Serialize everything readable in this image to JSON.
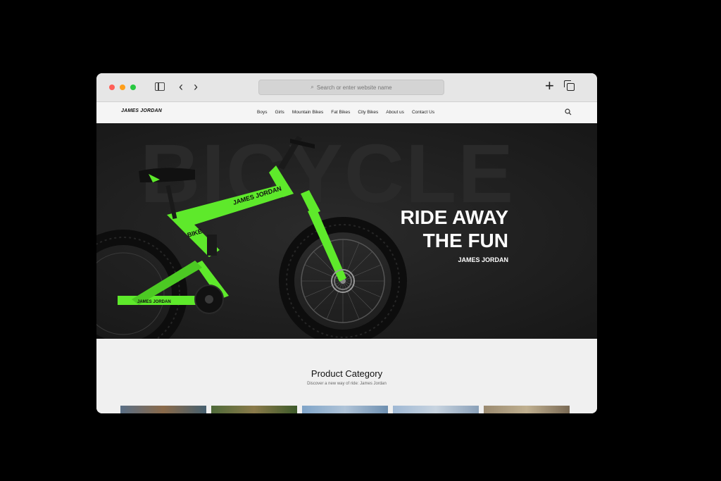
{
  "browser": {
    "url_placeholder": "Search or enter website name",
    "new_tab_symbol": "+"
  },
  "site": {
    "logo": "JAMES JORDAN",
    "menu": [
      "Boys",
      "Girls",
      "Mountain Bikes",
      "Fat Bikes",
      "City Bikes",
      "About us",
      "Contact Us"
    ]
  },
  "hero": {
    "background_word": "BICYCLE",
    "title_line1": "RIDE AWAY",
    "title_line2": "THE FUN",
    "subtitle": "JAMES JORDAN",
    "bike_frame_text": "JAMES JORDAN",
    "bike_model_text": "BIKE",
    "accent_color": "#5ee92b"
  },
  "category": {
    "title": "Product Category",
    "subtitle": "Discover a new way of ride: James Jordan"
  }
}
